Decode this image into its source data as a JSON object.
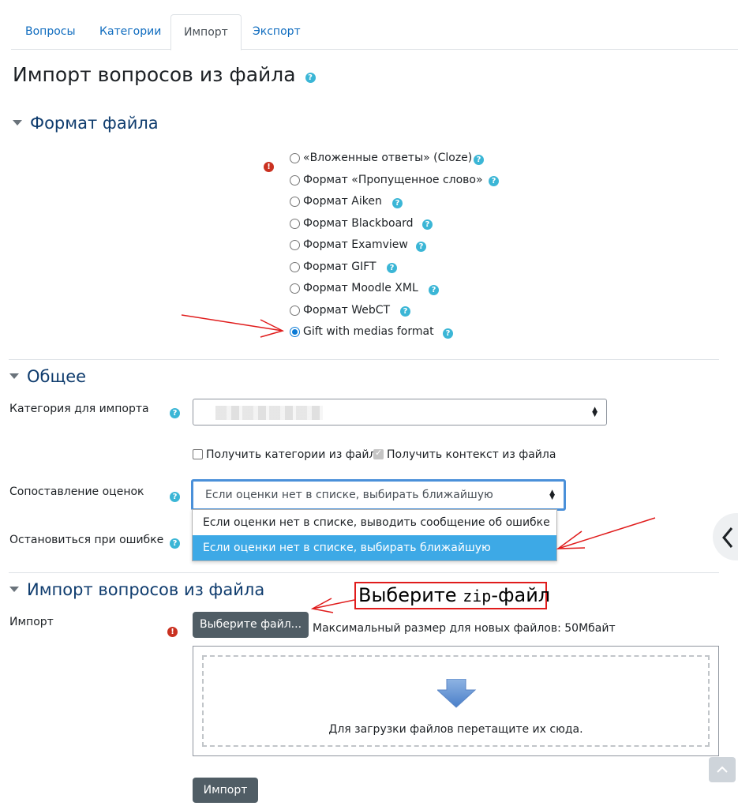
{
  "tabs": [
    {
      "label": "Вопросы"
    },
    {
      "label": "Категории"
    },
    {
      "label": "Импорт"
    },
    {
      "label": "Экспорт"
    }
  ],
  "page_title": "Импорт вопросов из файла",
  "format_section": {
    "heading": "Формат файла",
    "options": [
      {
        "label": "«Вложенные ответы» (Cloze)",
        "selected": false
      },
      {
        "label": "Формат «Пропущенное слово»",
        "selected": false
      },
      {
        "label": "Формат Aiken",
        "selected": false
      },
      {
        "label": "Формат Blackboard",
        "selected": false
      },
      {
        "label": "Формат Examview",
        "selected": false
      },
      {
        "label": "Формат GIFT",
        "selected": false
      },
      {
        "label": "Формат Moodle XML",
        "selected": false
      },
      {
        "label": "Формат WebCT",
        "selected": false
      },
      {
        "label": "Gift with medias format",
        "selected": true
      }
    ]
  },
  "general_section": {
    "heading": "Общее",
    "category_label": "Категория для импорта",
    "get_categories_label": "Получить категории из файла",
    "get_categories_checked": false,
    "get_context_label": "Получить контекст из файла",
    "get_context_checked": true,
    "grade_match_label": "Сопоставление оценок",
    "grade_match_value": "Если оценки нет в списке, выбирать ближайшую",
    "grade_match_options": [
      {
        "label": "Если оценки нет в списке, выводить сообщение об ошибке",
        "selected": false
      },
      {
        "label": "Если оценки нет в списке, выбирать ближайшую",
        "selected": true
      }
    ],
    "stop_on_error_label": "Остановиться при ошибке"
  },
  "import_section": {
    "heading": "Импорт вопросов из файла",
    "import_label": "Импорт",
    "choose_file_button": "Выберите файл...",
    "max_size_text": "Максимальный размер для новых файлов: 50Мбайт",
    "dropzone_text": "Для загрузки файлов перетащите их сюда.",
    "submit_button": "Импорт"
  },
  "annotation": {
    "text_before": "Выберите ",
    "text_mono": "zip",
    "text_after": "-файл"
  },
  "colors": {
    "link": "#0f6cbf",
    "heading": "#0f3c6e",
    "help_icon": "#3bb6d6",
    "error_icon": "#ca3120",
    "button": "#505d65",
    "dropdown_selected": "#3da9e6",
    "annotation_red": "#e01c1c"
  }
}
